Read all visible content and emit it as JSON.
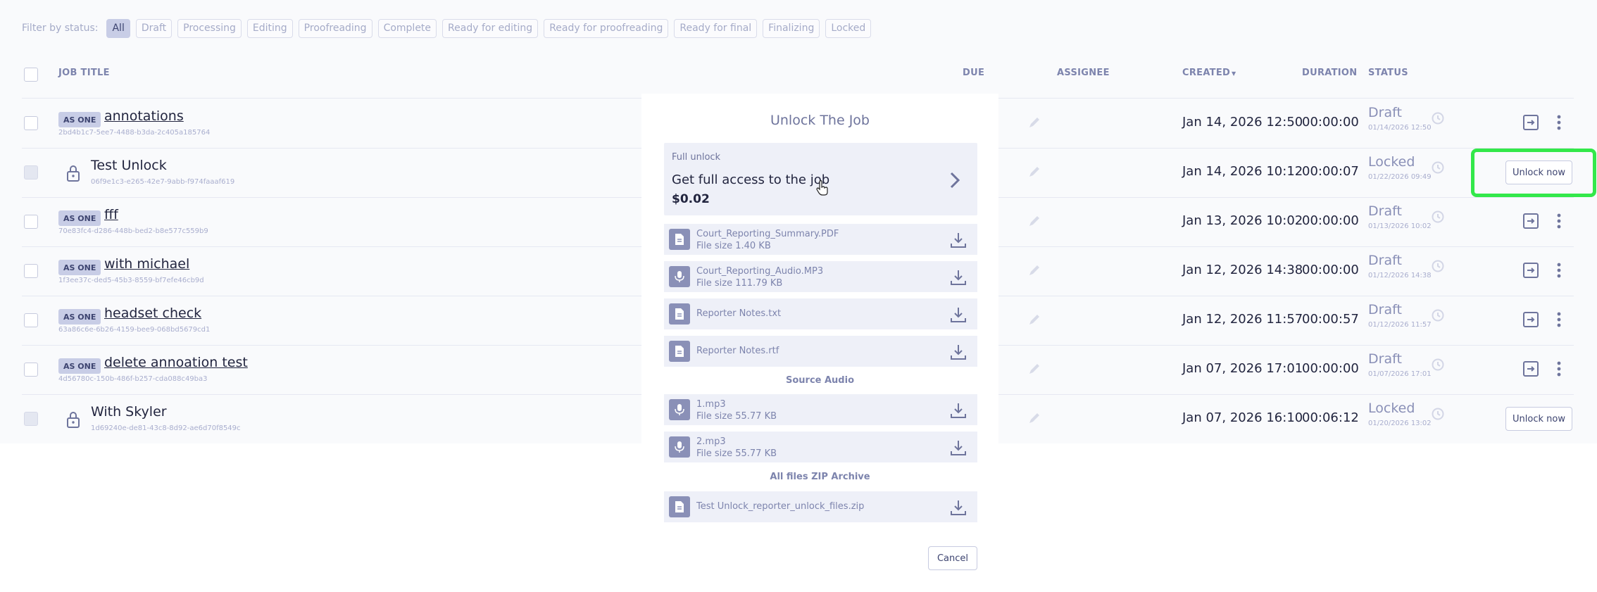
{
  "filters": {
    "label": "Filter by status:",
    "chips": [
      "All",
      "Draft",
      "Processing",
      "Editing",
      "Proofreading",
      "Complete",
      "Ready for editing",
      "Ready for proofreading",
      "Ready for final",
      "Finalizing",
      "Locked"
    ],
    "active": "All"
  },
  "table": {
    "headers": {
      "job_title": "JOB TITLE",
      "due": "DUE",
      "assignee": "ASSIGNEE",
      "created": "CREATED",
      "sort_arrow": "▼",
      "duration": "DURATION",
      "status": "STATUS"
    },
    "rows": [
      {
        "badge": "AS ONE",
        "title": "annotations",
        "uid": "2bd4b1c7-5ee7-4488-b3da-2c405a185764",
        "created": "Jan 14, 2026 12:50",
        "duration": "00:00:00",
        "status": "Draft",
        "status_date": "01/14/2026 12:50"
      },
      {
        "badge": "",
        "title": "Test Unlock",
        "uid": "06f9e1c3-e265-42e7-9abb-f974faaaf619",
        "created": "Jan 14, 2026 10:12",
        "duration": "00:00:07",
        "status": "Locked",
        "status_date": "01/22/2026 09:49",
        "action": "Unlock now"
      },
      {
        "badge": "AS ONE",
        "title": "fff",
        "uid": "70e83fc4-d286-448b-bed2-b8e577c559b9",
        "created": "Jan 13, 2026 10:02",
        "duration": "00:00:00",
        "status": "Draft",
        "status_date": "01/13/2026 10:02"
      },
      {
        "badge": "AS ONE",
        "title": "with michael",
        "uid": "1f3ee37c-ded5-45b3-8559-bf7efe46cb9d",
        "created": "Jan 12, 2026 14:38",
        "duration": "00:00:00",
        "status": "Draft",
        "status_date": "01/12/2026 14:38"
      },
      {
        "badge": "AS ONE",
        "title": "headset check",
        "uid": "63a86c6e-6b26-4159-bee9-068bd5679cd1",
        "created": "Jan 12, 2026 11:57",
        "duration": "00:00:57",
        "status": "Draft",
        "status_date": "01/12/2026 11:57"
      },
      {
        "badge": "AS ONE",
        "title": "delete annoation test",
        "uid": "4d56780c-150b-486f-b257-cda088c49ba3",
        "created": "Jan 07, 2026 17:01",
        "duration": "00:00:00",
        "status": "Draft",
        "status_date": "01/07/2026 17:01"
      },
      {
        "badge": "",
        "title": "With Skyler",
        "uid": "1d69240e-de81-43c8-8d92-ae6d70f8549c",
        "created": "Jan 07, 2026 16:10",
        "duration": "00:06:12",
        "status": "Locked",
        "status_date": "01/20/2026 13:02",
        "action": "Unlock now"
      }
    ]
  },
  "modal": {
    "title": "Unlock The Job",
    "full_unlock": {
      "label": "Full unlock",
      "description": "Get full access to the job",
      "price": "$0.02"
    },
    "files": [
      {
        "name": "Court_Reporting_Summary.PDF",
        "size": "File size 1.40 KB",
        "icon": "document-icon"
      },
      {
        "name": "Court_Reporting_Audio.MP3",
        "size": "File size 111.79 KB",
        "icon": "microphone-icon"
      },
      {
        "name": "Reporter Notes.txt",
        "size": "",
        "icon": "document-icon"
      },
      {
        "name": "Reporter Notes.rtf",
        "size": "",
        "icon": "document-icon"
      }
    ],
    "source_audio_label": "Source Audio",
    "audio_files": [
      {
        "name": "1.mp3",
        "size": "File size 55.77 KB",
        "icon": "microphone-icon"
      },
      {
        "name": "2.mp3",
        "size": "File size 55.77 KB",
        "icon": "microphone-icon"
      }
    ],
    "zip_label": "All files ZIP Archive",
    "zip_file": {
      "name": "Test Unlock_reporter_unlock_files.zip",
      "icon": "document-icon"
    },
    "cancel_label": "Cancel"
  },
  "colors": {
    "accent": "#8a90b7",
    "highlight": "#33e84a",
    "chip_active": "#c8cde6"
  }
}
